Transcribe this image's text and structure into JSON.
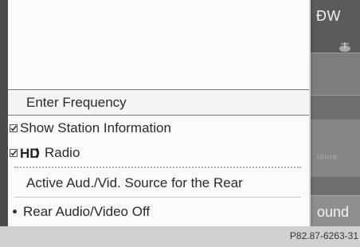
{
  "background": {
    "top_right_label": "ÐW",
    "bottom_right_label": "ound",
    "blurred_text": "ionie"
  },
  "menu": {
    "items": [
      {
        "label": "Enter Frequency",
        "type": "plain"
      },
      {
        "label": "Show Station Information",
        "type": "checkbox",
        "checked": true
      },
      {
        "label": "Radio",
        "type": "checkbox",
        "checked": true,
        "icon": "hd-radio-icon"
      },
      {
        "label": "Active Aud./Vid. Source for the Rear",
        "type": "plain"
      },
      {
        "label": "Rear Audio/Video Off",
        "type": "radio",
        "selected": true
      }
    ],
    "selected_index": 0
  },
  "footer": {
    "code": "P82.87-6263-31"
  },
  "colors": {
    "menu_background": "#fafafa",
    "selection_border": "#7a7a7a",
    "screen_background": "#7c7c7c"
  }
}
